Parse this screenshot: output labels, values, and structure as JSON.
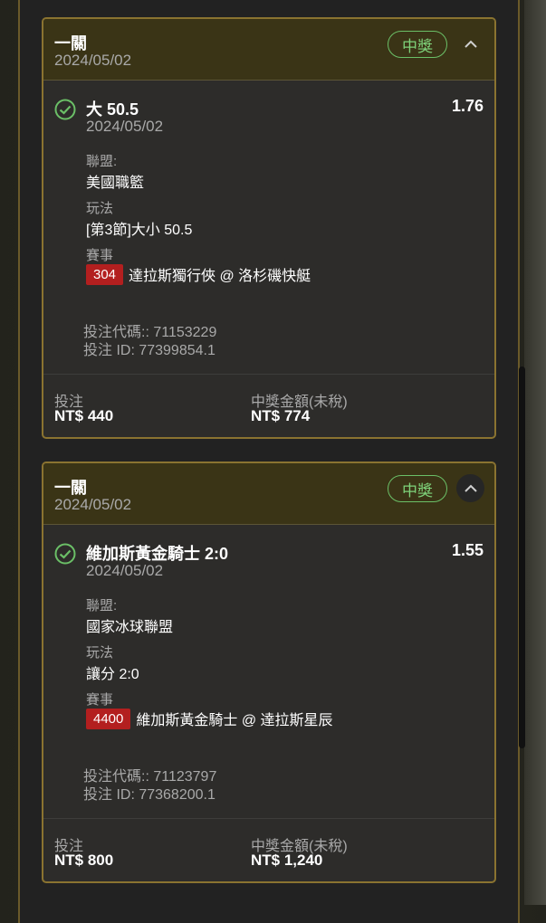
{
  "cards": [
    {
      "header_title": "一關",
      "header_date": "2024/05/02",
      "status": "中獎",
      "selection": "大 50.5",
      "odds": "1.76",
      "selection_date": "2024/05/02",
      "league_label": "聯盟:",
      "league": "美國職籃",
      "market_label": "玩法",
      "market": "[第3節]大小 50.5",
      "event_label": "賽事",
      "event_code": "304",
      "event_name": "達拉斯獨行俠 @ 洛杉磯快艇",
      "bet_code": "投注代碼:: 71153229",
      "bet_id": "投注 ID: 77399854.1",
      "stake_label": "投注",
      "stake": "NT$ 440",
      "payout_label": "中獎金額(未稅)",
      "payout": "NT$ 774"
    },
    {
      "header_title": "一關",
      "header_date": "2024/05/02",
      "status": "中獎",
      "selection": "維加斯黃金騎士 2:0",
      "odds": "1.55",
      "selection_date": "2024/05/02",
      "league_label": "聯盟:",
      "league": "國家冰球聯盟",
      "market_label": "玩法",
      "market": "讓分 2:0",
      "event_label": "賽事",
      "event_code": "4400",
      "event_name": "維加斯黃金騎士 @ 達拉斯星辰",
      "bet_code": "投注代碼:: 71123797",
      "bet_id": "投注 ID: 77368200.1",
      "stake_label": "投注",
      "stake": "NT$ 800",
      "payout_label": "中獎金額(未稅)",
      "payout": "NT$ 1,240"
    }
  ],
  "icons": {
    "check": "check-circle-icon",
    "collapse": "chevron-up-icon"
  },
  "colors": {
    "accent_gold": "#8a7330",
    "win_green": "#7ed27a",
    "event_code_red": "#b31f1f"
  }
}
